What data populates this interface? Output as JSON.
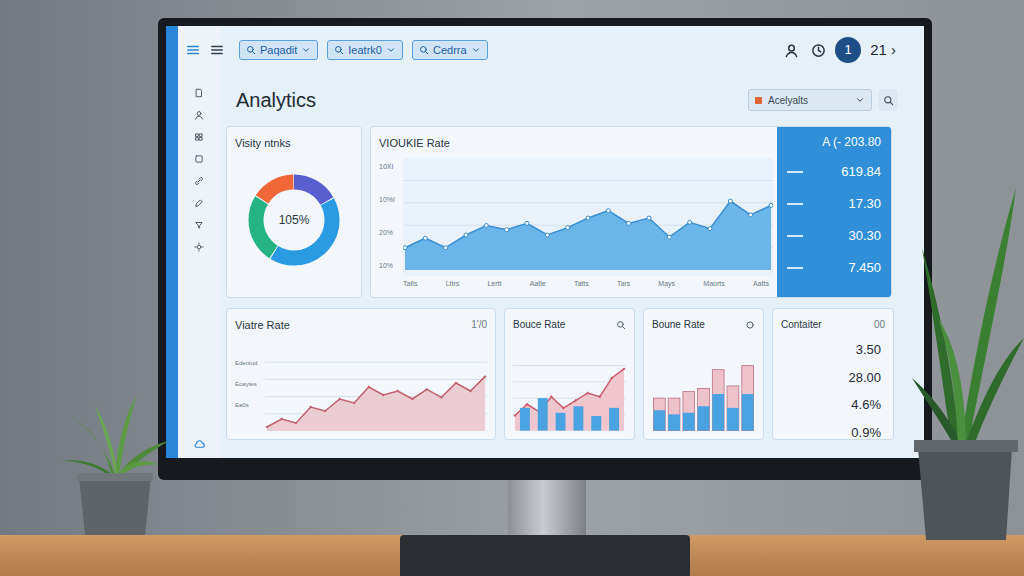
{
  "filters": [
    {
      "label": "Paqadit"
    },
    {
      "label": "Ieatrk0"
    },
    {
      "label": "Cedrra"
    }
  ],
  "user": {
    "badge": "1",
    "count": "21 ›"
  },
  "page": {
    "title": "Analytics",
    "selector": "Acelyalts"
  },
  "donut_card": {
    "title": "Visity ntnks",
    "center": "105%",
    "segments": [
      {
        "value": 17,
        "color": "#5a5fd0"
      },
      {
        "value": 42,
        "color": "#2a9ae2"
      },
      {
        "value": 25,
        "color": "#25b383"
      },
      {
        "value": 16,
        "color": "#f0683a"
      }
    ]
  },
  "main_chart": {
    "title": "VIOUKIE Rate",
    "y_ticks": [
      "10XI",
      "10%I",
      "20%",
      "10%"
    ],
    "x_labels": [
      "Tatls",
      "Lttrs",
      "Lertt",
      "Aatle",
      "Tatts",
      "Tars",
      "Mays",
      "Maorts",
      "Aatts"
    ],
    "series": [
      21,
      30,
      21,
      33,
      42,
      38,
      44,
      33,
      40,
      49,
      56,
      44,
      49,
      31,
      45,
      39,
      65,
      52,
      61
    ]
  },
  "highlight_panel": {
    "header": "A  (- 203.80",
    "rows": [
      "619.84",
      "17.30",
      "30.30",
      "7.450"
    ]
  },
  "visitor_card": {
    "title": "Viatre Rate",
    "corner": "1'/0",
    "y_ticks": [
      "Edentud",
      "Eoaytes",
      "Ea0s"
    ],
    "series": [
      5,
      15,
      10,
      30,
      25,
      40,
      35,
      55,
      45,
      50,
      40,
      52,
      42,
      60,
      50,
      68
    ]
  },
  "bounce_card": {
    "title": "Bouce Rate",
    "series": [
      20,
      35,
      25,
      45,
      30,
      40,
      50,
      45,
      70,
      82
    ],
    "bars": [
      28,
      40,
      22,
      30,
      18,
      28
    ]
  },
  "bounce_card_2": {
    "title": "Boune Rate",
    "bars": [
      40,
      40,
      48,
      52,
      75,
      55,
      80
    ],
    "inner_bars": [
      25,
      20,
      22,
      30,
      45,
      28,
      45
    ]
  },
  "container_card": {
    "title": "Contaiter",
    "corner": "00",
    "values": [
      "3.50",
      "28.00",
      "4.6%",
      "0.9%"
    ]
  }
}
